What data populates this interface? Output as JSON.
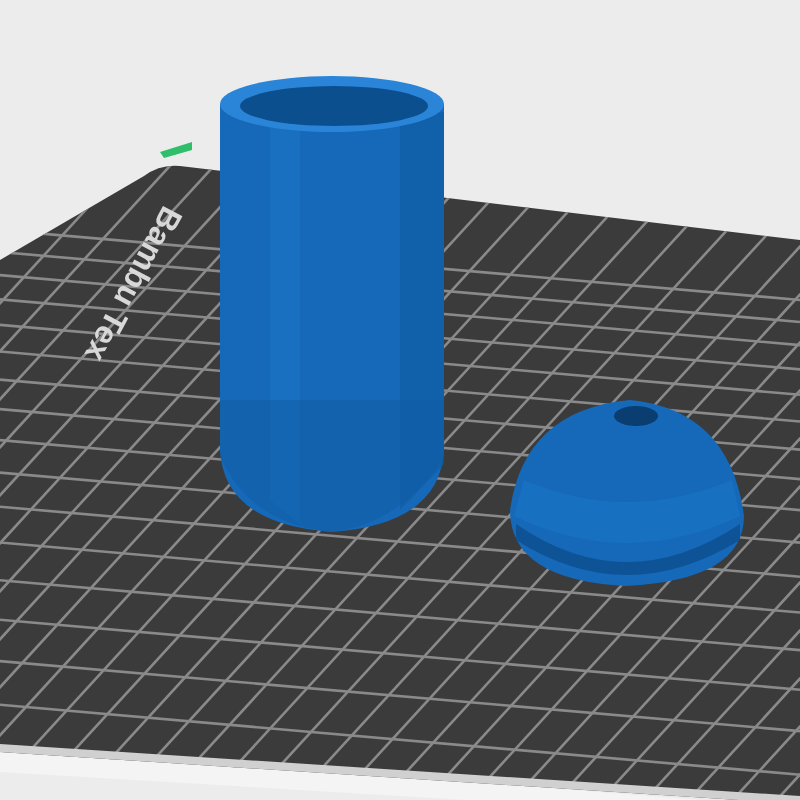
{
  "viewport": {
    "plate": {
      "label": "Bambu Tex"
    },
    "objects": [
      {
        "kind": "cylinder"
      },
      {
        "kind": "dome"
      }
    ]
  }
}
